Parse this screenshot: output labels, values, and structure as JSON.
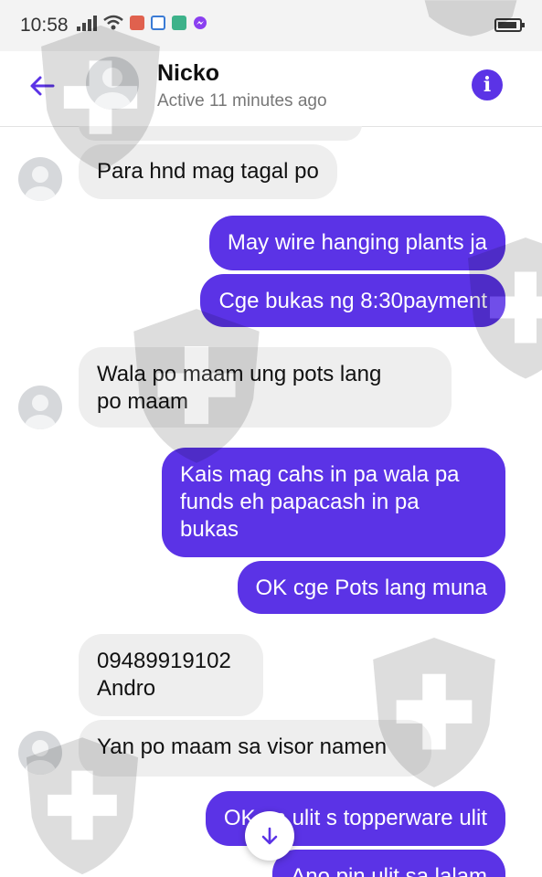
{
  "status_bar": {
    "time": "10:58",
    "icons": [
      "signal-icon",
      "wifi-icon",
      "app-icon",
      "app-icon",
      "app-icon",
      "messenger-icon",
      "battery-icon"
    ]
  },
  "header": {
    "contact_name": "Nicko",
    "status": "Active 11 minutes ago",
    "accent": "#5b33e6"
  },
  "messages": [
    {
      "direction": "incoming",
      "text": "Para hnd mag tagal po"
    },
    {
      "direction": "outgoing",
      "text": "May wire hanging plants ja"
    },
    {
      "direction": "outgoing",
      "text": "Cge bukas ng 8:30payment"
    },
    {
      "direction": "incoming",
      "text": "Wala po maam ung pots lang\npo maam"
    },
    {
      "direction": "outgoing",
      "text": "Kais mag cahs in pa wala pa\nfunds eh papacash in pa\nbukas"
    },
    {
      "direction": "outgoing",
      "text": "OK cge Pots lang muna"
    },
    {
      "direction": "incoming",
      "text": "09489919102\nAndro"
    },
    {
      "direction": "incoming",
      "text": "Yan po maam sa visor namen"
    },
    {
      "direction": "outgoing",
      "text": "OK an      ulit s topperware ulit"
    },
    {
      "direction": "outgoing",
      "text": "Ano pin ulit sa lalam"
    }
  ],
  "colors": {
    "outgoing_bubble": "#5b33e6",
    "incoming_bubble": "#eeeeee"
  }
}
